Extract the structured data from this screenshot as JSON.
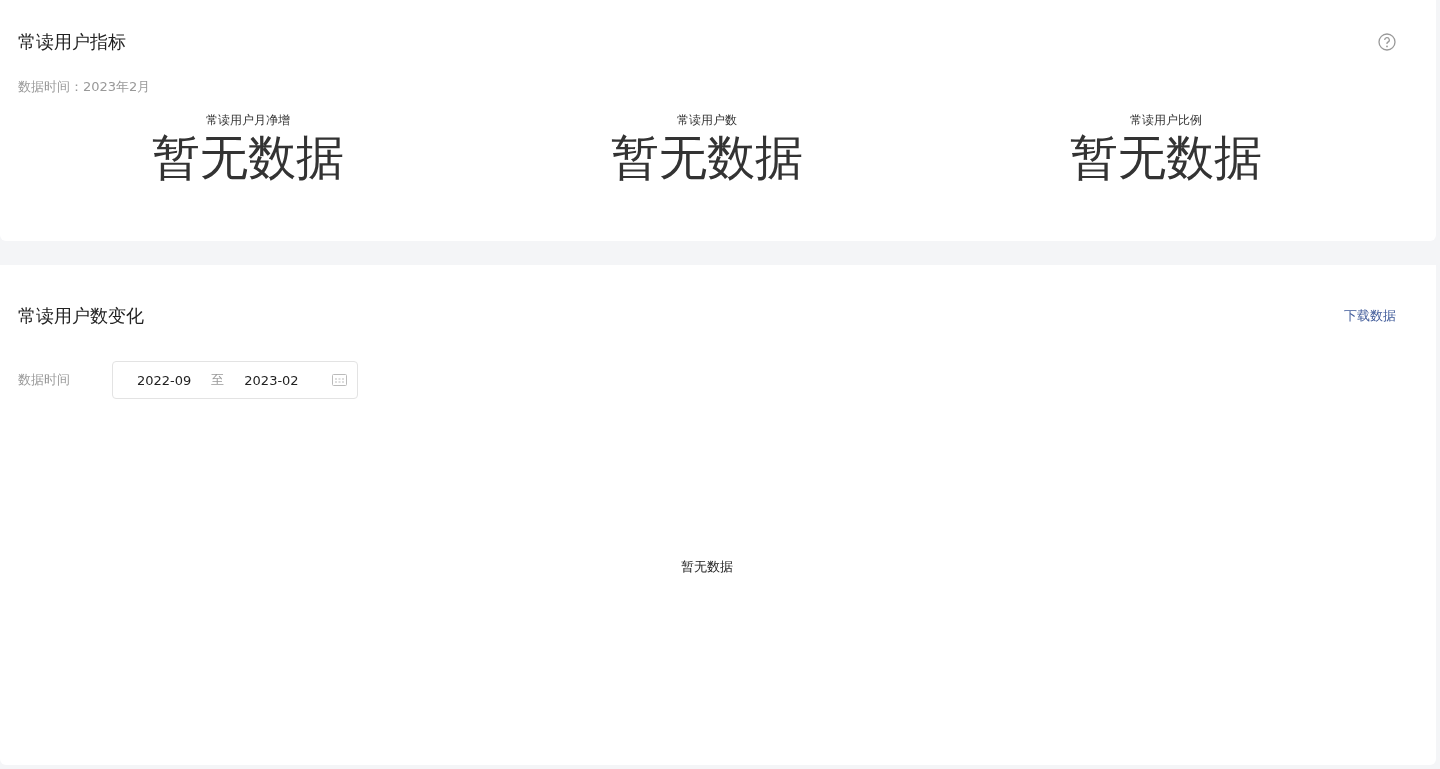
{
  "metrics_card": {
    "title": "常读用户指标",
    "data_time": "数据时间：2023年2月",
    "metrics": [
      {
        "label": "常读用户月净增",
        "value": "暂无数据"
      },
      {
        "label": "常读用户数",
        "value": "暂无数据"
      },
      {
        "label": "常读用户比例",
        "value": "暂无数据"
      }
    ]
  },
  "trend_card": {
    "title": "常读用户数变化",
    "download_link": "下载数据",
    "filter_label": "数据时间",
    "range": {
      "start": "2022-09",
      "separator": "至",
      "end": "2023-02"
    },
    "empty_text": "暂无数据"
  }
}
